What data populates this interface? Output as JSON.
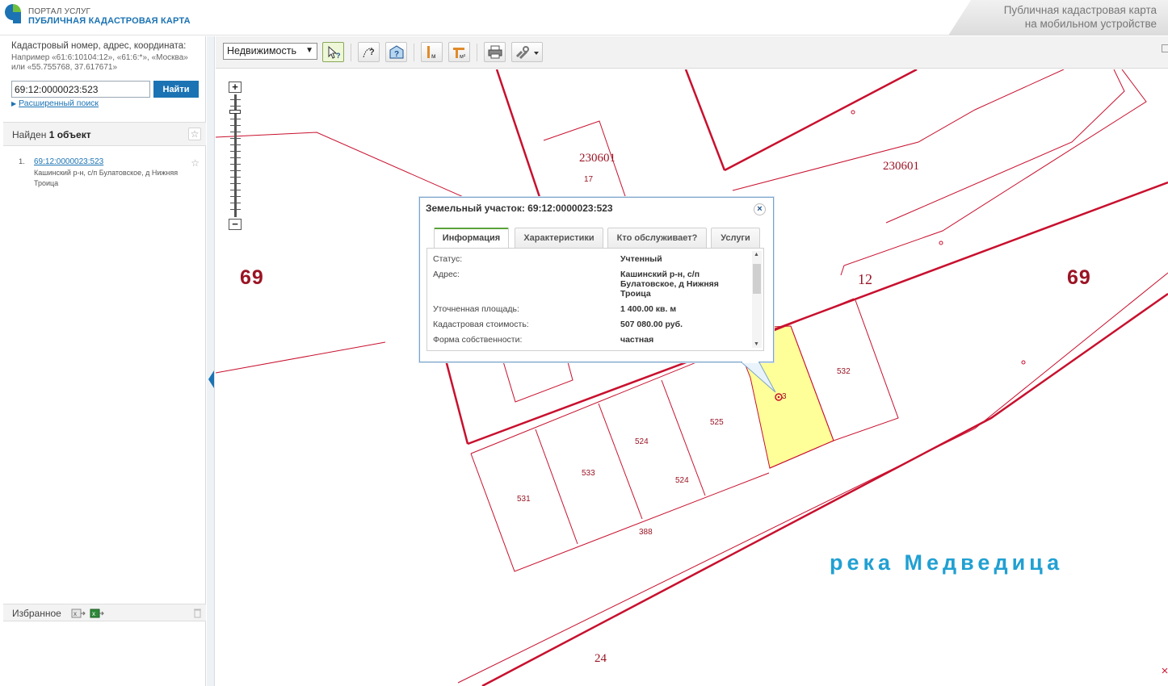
{
  "header": {
    "portal_label": "ПОРТАЛ УСЛУГ",
    "app_title": "ПУБЛИЧНАЯ КАДАСТРОВАЯ КАРТА",
    "mobile_line1": "Публичная кадастровая карта",
    "mobile_line2": "на мобильном устройстве"
  },
  "search": {
    "hint_title": "Кадастровый номер, адрес, координата:",
    "hint_example": "Например «61:6:10104:12», «61:6:*», «Москва» или «55.755768, 37.617671»",
    "input_value": "69:12:0000023:523",
    "button_label": "Найти",
    "advanced_label": "Расширенный поиск"
  },
  "results": {
    "found_prefix": "Найден",
    "found_count": "1 объект",
    "items": [
      {
        "num": "1.",
        "cadastral_number": "69:12:0000023:523",
        "address": "Кашинский р-н, с/п Булатовское, д Нижняя Троица"
      }
    ]
  },
  "favorites": {
    "label": "Избранное"
  },
  "toolbar": {
    "layer_select": "Недвижимость",
    "icons": [
      "pointer-identify-icon",
      "measure-help-icon",
      "map-help-icon",
      "measure-length-icon",
      "measure-area-icon",
      "print-icon",
      "link-icon"
    ]
  },
  "map": {
    "region_left": "69",
    "region_right": "69",
    "quarter_a": "230601",
    "quarter_b": "230601",
    "parcel_17": "17",
    "parcel_12": "12",
    "parcel_532": "532",
    "parcel_525": "525",
    "parcel_524a": "524",
    "parcel_524b": "524",
    "parcel_533": "533",
    "parcel_531": "531",
    "parcel_388": "388",
    "parcel_24": "24",
    "parcel_selected_suffix": "3",
    "river": "река Медведица",
    "selected_fill": "#ffff99",
    "boundary_color": "#c8102e"
  },
  "popup": {
    "title": "Земельный участок: 69:12:0000023:523",
    "tabs": [
      "Информация",
      "Характеристики",
      "Кто обслуживает?",
      "Услуги"
    ],
    "rows": [
      {
        "label": "Статус:",
        "value": "Учтенный"
      },
      {
        "label": "Адрес:",
        "value": "Кашинский р-н, с/п Булатовское, д Нижняя Троица"
      },
      {
        "label": "Уточненная площадь:",
        "value": "1 400.00 кв. м"
      },
      {
        "label": "Кадастровая стоимость:",
        "value": "507 080.00 руб."
      },
      {
        "label": "Форма собственности:",
        "value": "частная"
      }
    ]
  }
}
